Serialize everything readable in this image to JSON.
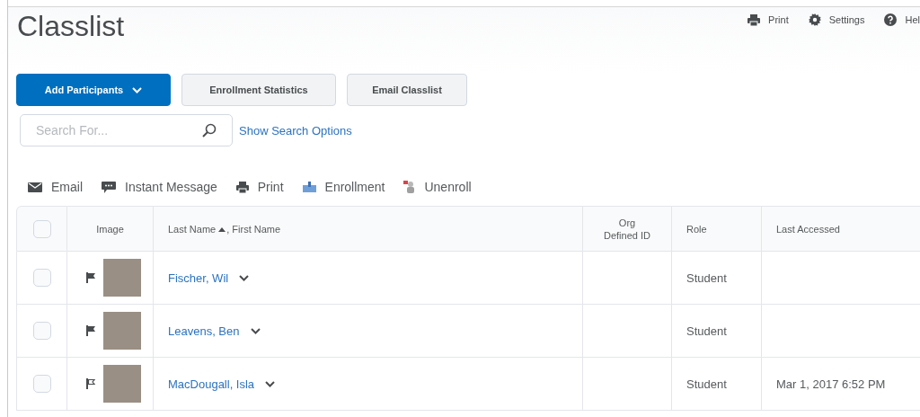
{
  "page": {
    "title": "Classlist"
  },
  "top_links": [
    {
      "kind": "print",
      "label": "Print"
    },
    {
      "kind": "settings",
      "label": "Settings"
    },
    {
      "kind": "help",
      "label": "Hel"
    }
  ],
  "buttons": [
    {
      "label": "Add Participants",
      "primary": true,
      "dropdown": true
    },
    {
      "label": "Enrollment Statistics",
      "primary": false,
      "dropdown": false
    },
    {
      "label": "Email Classlist",
      "primary": false,
      "dropdown": false
    }
  ],
  "search": {
    "placeholder": "Search For...",
    "options_link": "Show Search Options"
  },
  "actions": [
    {
      "kind": "email",
      "label": "Email"
    },
    {
      "kind": "message",
      "label": "Instant Message"
    },
    {
      "kind": "print",
      "label": "Print"
    },
    {
      "kind": "enrollment",
      "label": "Enrollment"
    },
    {
      "kind": "unenroll",
      "label": "Unenroll"
    }
  ],
  "table": {
    "select_all_checked": false,
    "columns": [
      {
        "kind": "select"
      },
      {
        "kind": "image",
        "label": "Image"
      },
      {
        "kind": "name",
        "label": "Last Name",
        "label_2": ", First Name"
      },
      {
        "kind": "id",
        "label": "Org Defined ID"
      },
      {
        "kind": "text",
        "label": "Role"
      },
      {
        "kind": "text",
        "label": "Last Accessed"
      }
    ],
    "rows": [
      {
        "checked": false,
        "flagged": true,
        "name": "Fischer, Wil",
        "role": "Student"
      },
      {
        "checked": false,
        "flagged": true,
        "name": "Leavens, Ben",
        "role": "Student"
      },
      {
        "checked": false,
        "flagged": false,
        "name": "MacDougall, Isla",
        "role": "Student",
        "last_accessed": "Mar 1, 2017 6:52 PM"
      }
    ]
  }
}
